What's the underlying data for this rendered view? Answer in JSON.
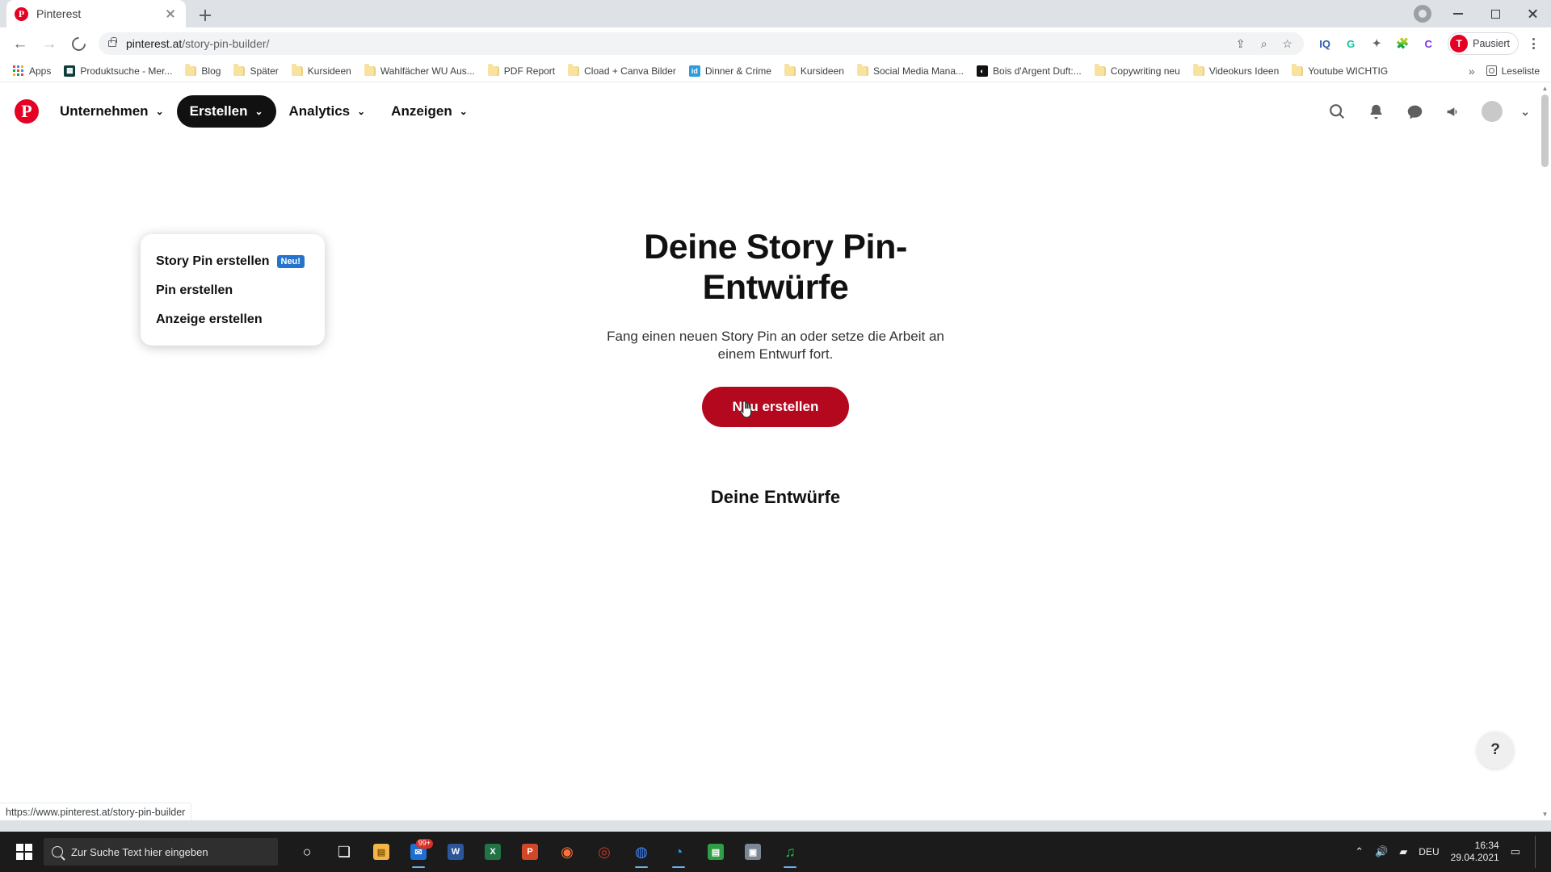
{
  "browser": {
    "tab": {
      "title": "Pinterest",
      "favicon": "pinterest-icon",
      "close_icon": "close-icon"
    },
    "new_tab_icon": "plus-icon",
    "window_controls": {
      "minimize": "minimize-icon",
      "maximize": "maximize-icon",
      "close": "close-icon"
    },
    "nav": {
      "back_icon": "back-arrow-icon",
      "forward_icon": "forward-arrow-icon",
      "reload_icon": "reload-icon"
    },
    "omnibox": {
      "lock_icon": "lock-icon",
      "url_domain": "pinterest.at",
      "url_path": "/story-pin-builder/",
      "icons": [
        "share-icon",
        "zoom-icon",
        "star-icon"
      ]
    },
    "extensions": [
      {
        "name": "iq-extension",
        "label": "IQ"
      },
      {
        "name": "grammarly-extension",
        "label": "G"
      },
      {
        "name": "puzzle-extension",
        "label": "extensions-icon"
      },
      {
        "name": "canva-extension",
        "label": "C"
      }
    ],
    "profile": {
      "avatar_initial": "T",
      "label": "Pausiert"
    },
    "menu_icon": "kebab-menu-icon",
    "bookmarks": [
      {
        "label": "Apps",
        "icon": "apps-grid-icon"
      },
      {
        "label": "Produktsuche - Mer...",
        "icon": "site-favicon"
      },
      {
        "label": "Blog",
        "icon": "folder-icon"
      },
      {
        "label": "Später",
        "icon": "folder-icon"
      },
      {
        "label": "Kursideen",
        "icon": "folder-icon"
      },
      {
        "label": "Wahlfächer WU Aus...",
        "icon": "folder-icon"
      },
      {
        "label": "PDF Report",
        "icon": "folder-icon"
      },
      {
        "label": "Cload + Canva Bilder",
        "icon": "folder-icon"
      },
      {
        "label": "Dinner & Crime",
        "icon": "id-favicon"
      },
      {
        "label": "Kursideen",
        "icon": "folder-icon"
      },
      {
        "label": "Social Media Mana...",
        "icon": "folder-icon"
      },
      {
        "label": "Bois d'Argent Duft:...",
        "icon": "dior-favicon"
      },
      {
        "label": "Copywriting neu",
        "icon": "folder-icon"
      },
      {
        "label": "Videokurs Ideen",
        "icon": "folder-icon"
      },
      {
        "label": "Youtube WICHTIG",
        "icon": "folder-icon"
      }
    ],
    "bookmarks_overflow_icon": "chevron-double-right-icon",
    "reading_list": {
      "label": "Leseliste",
      "icon": "reading-list-icon"
    },
    "status_url": "https://www.pinterest.at/story-pin-builder"
  },
  "pinterest": {
    "logo": "pinterest-logo",
    "nav_items": [
      {
        "label": "Unternehmen",
        "active": false,
        "chevron": "chevron-down-icon"
      },
      {
        "label": "Erstellen",
        "active": true,
        "chevron": "chevron-down-icon"
      },
      {
        "label": "Analytics",
        "active": false,
        "chevron": "chevron-down-icon"
      },
      {
        "label": "Anzeigen",
        "active": false,
        "chevron": "chevron-down-icon"
      }
    ],
    "nav_right_icons": [
      "search-icon",
      "bell-icon",
      "chat-icon",
      "megaphone-icon",
      "avatar",
      "chevron-down-icon"
    ],
    "dropdown": {
      "items": [
        {
          "label": "Story Pin erstellen",
          "badge": "Neu!"
        },
        {
          "label": "Pin erstellen",
          "badge": ""
        },
        {
          "label": "Anzeige erstellen",
          "badge": ""
        }
      ]
    },
    "hero": {
      "title": "Deine Story Pin-Entwürfe",
      "subtitle": "Fang einen neuen Story Pin an oder setze die Arbeit an einem Entwurf fort.",
      "cta": "Neu erstellen",
      "cta_color": "#b4081f"
    },
    "drafts_heading": "Deine Entwürfe",
    "help_button": "?"
  },
  "taskbar": {
    "start_icon": "windows-logo-icon",
    "search_placeholder": "Zur Suche Text hier eingeben",
    "search_icon": "search-icon",
    "items": [
      {
        "name": "cortana-icon",
        "glyph": "○",
        "running": false,
        "badge": ""
      },
      {
        "name": "task-view-icon",
        "glyph": "❏",
        "running": false,
        "badge": ""
      },
      {
        "name": "file-explorer-icon",
        "glyph": "📁",
        "running": false,
        "badge": ""
      },
      {
        "name": "mail-icon",
        "glyph": "✉",
        "running": true,
        "badge": "99+"
      },
      {
        "name": "word-icon",
        "glyph": "W",
        "running": false,
        "badge": ""
      },
      {
        "name": "excel-icon",
        "glyph": "X",
        "running": false,
        "badge": ""
      },
      {
        "name": "powerpoint-icon",
        "glyph": "P",
        "running": false,
        "badge": ""
      },
      {
        "name": "firefox-icon",
        "glyph": "◉",
        "running": false,
        "badge": ""
      },
      {
        "name": "opera-icon",
        "glyph": "◎",
        "running": false,
        "badge": ""
      },
      {
        "name": "chrome-icon",
        "glyph": "◍",
        "running": true,
        "badge": ""
      },
      {
        "name": "edge-icon",
        "glyph": "◔",
        "running": true,
        "badge": ""
      },
      {
        "name": "app-green-icon",
        "glyph": "▤",
        "running": false,
        "badge": ""
      },
      {
        "name": "photos-icon",
        "glyph": "▣",
        "running": false,
        "badge": ""
      },
      {
        "name": "spotify-icon",
        "glyph": "♫",
        "running": true,
        "badge": ""
      }
    ],
    "tray": {
      "chevron": "chevron-up-icon",
      "volume_icon": "volume-icon",
      "network_icon": "network-icon",
      "language": "DEU",
      "time": "16:34",
      "date": "29.04.2021",
      "notification_icon": "notification-icon"
    }
  }
}
